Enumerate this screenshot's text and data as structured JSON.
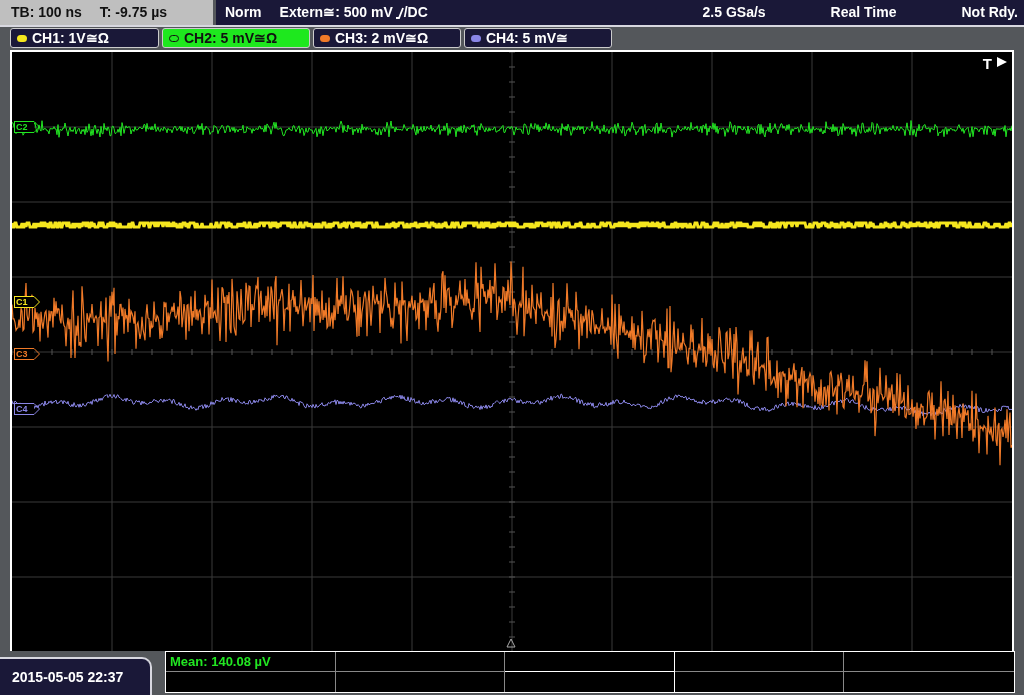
{
  "status_bar": {
    "timebase": "TB: 100 ns",
    "trigger_time": "T: -9.75 µs",
    "mode": "Norm",
    "trigger_source": "Extern≅: 500 mV",
    "coupling": "/DC",
    "sample_rate": "2.5 GSa/s",
    "acquisition": "Real Time",
    "state": "Not Rdy."
  },
  "channels": [
    {
      "label": "CH1: 1V≅Ω",
      "color": "#f5e61e",
      "selected": false
    },
    {
      "label": "CH2: 5 mV≅Ω",
      "color": "#22e622",
      "selected": true
    },
    {
      "label": "CH3: 2 mV≅Ω",
      "color": "#f07a28",
      "selected": false
    },
    {
      "label": "CH4: 5 mV≅",
      "color": "#8a86e6",
      "selected": false
    }
  ],
  "markers": [
    {
      "label": "C2",
      "color": "#22e622"
    },
    {
      "label": "C1",
      "color": "#f5e61e"
    },
    {
      "label": "C3",
      "color": "#f07a28"
    },
    {
      "label": "C4",
      "color": "#8a86e6"
    }
  ],
  "trigger_marker": "T",
  "timestamp": "2015-05-05 22:37",
  "measurement": "Mean: 140.08 µV"
}
